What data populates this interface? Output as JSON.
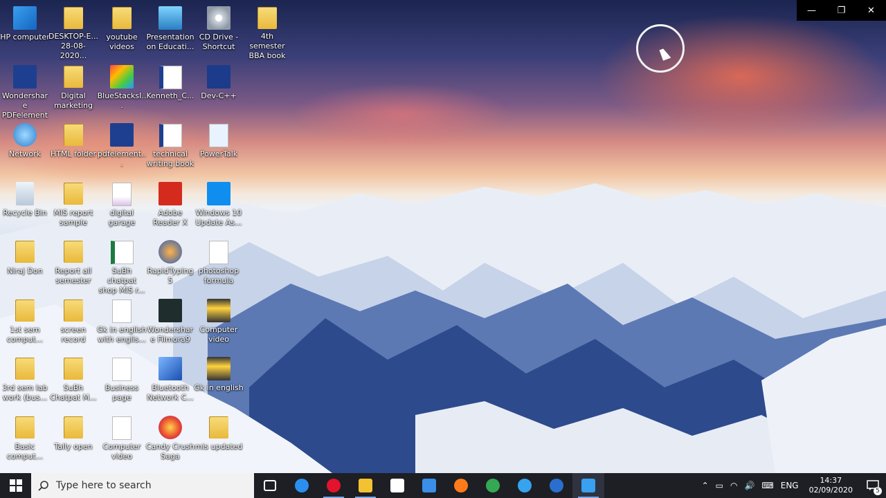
{
  "window_controls": {
    "minimize": "—",
    "restore": "❐",
    "close": "✕"
  },
  "desktop_icons": [
    {
      "label": "HP computer",
      "icon": "computer-icon"
    },
    {
      "label": "DESKTOP-E... 28-08-2020...",
      "icon": "folder-icon"
    },
    {
      "label": "youtube videos",
      "icon": "folder-icon"
    },
    {
      "label": "Presentation on Educati...",
      "icon": "presentation-icon"
    },
    {
      "label": "CD Drive - Shortcut",
      "icon": "dvd-drive-icon"
    },
    {
      "label": "4th semester BBA book",
      "icon": "folder-icon"
    },
    {
      "label": "Wondershare PDFelement",
      "icon": "pdfelement-icon"
    },
    {
      "label": "Digital marketing",
      "icon": "folder-icon"
    },
    {
      "label": "BlueStacksI...",
      "icon": "bluestacks-icon"
    },
    {
      "label": "Kenneth_C...",
      "icon": "pdf-document-icon"
    },
    {
      "label": "Dev-C++",
      "icon": "dev-cpp-icon"
    },
    {
      "label": "Network",
      "icon": "network-icon"
    },
    {
      "label": "HTML folder",
      "icon": "folder-icon"
    },
    {
      "label": "pdfelement...",
      "icon": "pdfelement-icon"
    },
    {
      "label": "technical writing book",
      "icon": "pdf-document-icon"
    },
    {
      "label": "PowerTalk",
      "icon": "powertalk-icon"
    },
    {
      "label": "Recycle Bin",
      "icon": "recycle-bin-icon"
    },
    {
      "label": "MIS report sample",
      "icon": "folder-icon"
    },
    {
      "label": "digital garage",
      "icon": "xel-document-icon"
    },
    {
      "label": "Adobe Reader X",
      "icon": "adobe-reader-icon"
    },
    {
      "label": "Windows 10 Update As...",
      "icon": "windows-icon"
    },
    {
      "label": "Niraj Don",
      "icon": "user-folder-icon"
    },
    {
      "label": "Report all semester",
      "icon": "folder-icon"
    },
    {
      "label": "SuBh chatpat shop MIS r...",
      "icon": "excel-icon"
    },
    {
      "label": "RapidTyping 5",
      "icon": "rapidtyping-icon"
    },
    {
      "label": "photoshop formula",
      "icon": "text-document-icon"
    },
    {
      "label": "1st sem comput...",
      "icon": "folder-icon"
    },
    {
      "label": "screen record",
      "icon": "folder-icon"
    },
    {
      "label": "Gk in english with englis...",
      "icon": "document-icon"
    },
    {
      "label": "Wondershare Filmora9",
      "icon": "filmora-icon"
    },
    {
      "label": "Computer video",
      "icon": "video-icon"
    },
    {
      "label": "3rd sem lab work (bus...",
      "icon": "folder-icon"
    },
    {
      "label": "SuBh Chatpat M...",
      "icon": "folder-icon"
    },
    {
      "label": "Business page",
      "icon": "document-icon"
    },
    {
      "label": "Bluetooth Network C...",
      "icon": "bluetooth-icon"
    },
    {
      "label": "Gk in english",
      "icon": "video-icon"
    },
    {
      "label": "Basic comput...",
      "icon": "folder-icon"
    },
    {
      "label": "Tally open",
      "icon": "folder-icon"
    },
    {
      "label": "Computer video",
      "icon": "document-icon"
    },
    {
      "label": "Candy Crush Saga",
      "icon": "candy-crush-icon"
    },
    {
      "label": "mis updated",
      "icon": "zip-folder-icon"
    }
  ],
  "taskbar": {
    "search_placeholder": "Type here to search",
    "apps": [
      "task-view-icon",
      "edge-icon",
      "opera-icon",
      "file-explorer-icon",
      "store-icon",
      "mail-icon",
      "firefox-icon",
      "chrome-icon",
      "ie-icon",
      "imo-icon",
      "media-player-icon"
    ],
    "language": "ENG",
    "time": "14:37",
    "date": "02/09/2020",
    "notifications": "5"
  }
}
